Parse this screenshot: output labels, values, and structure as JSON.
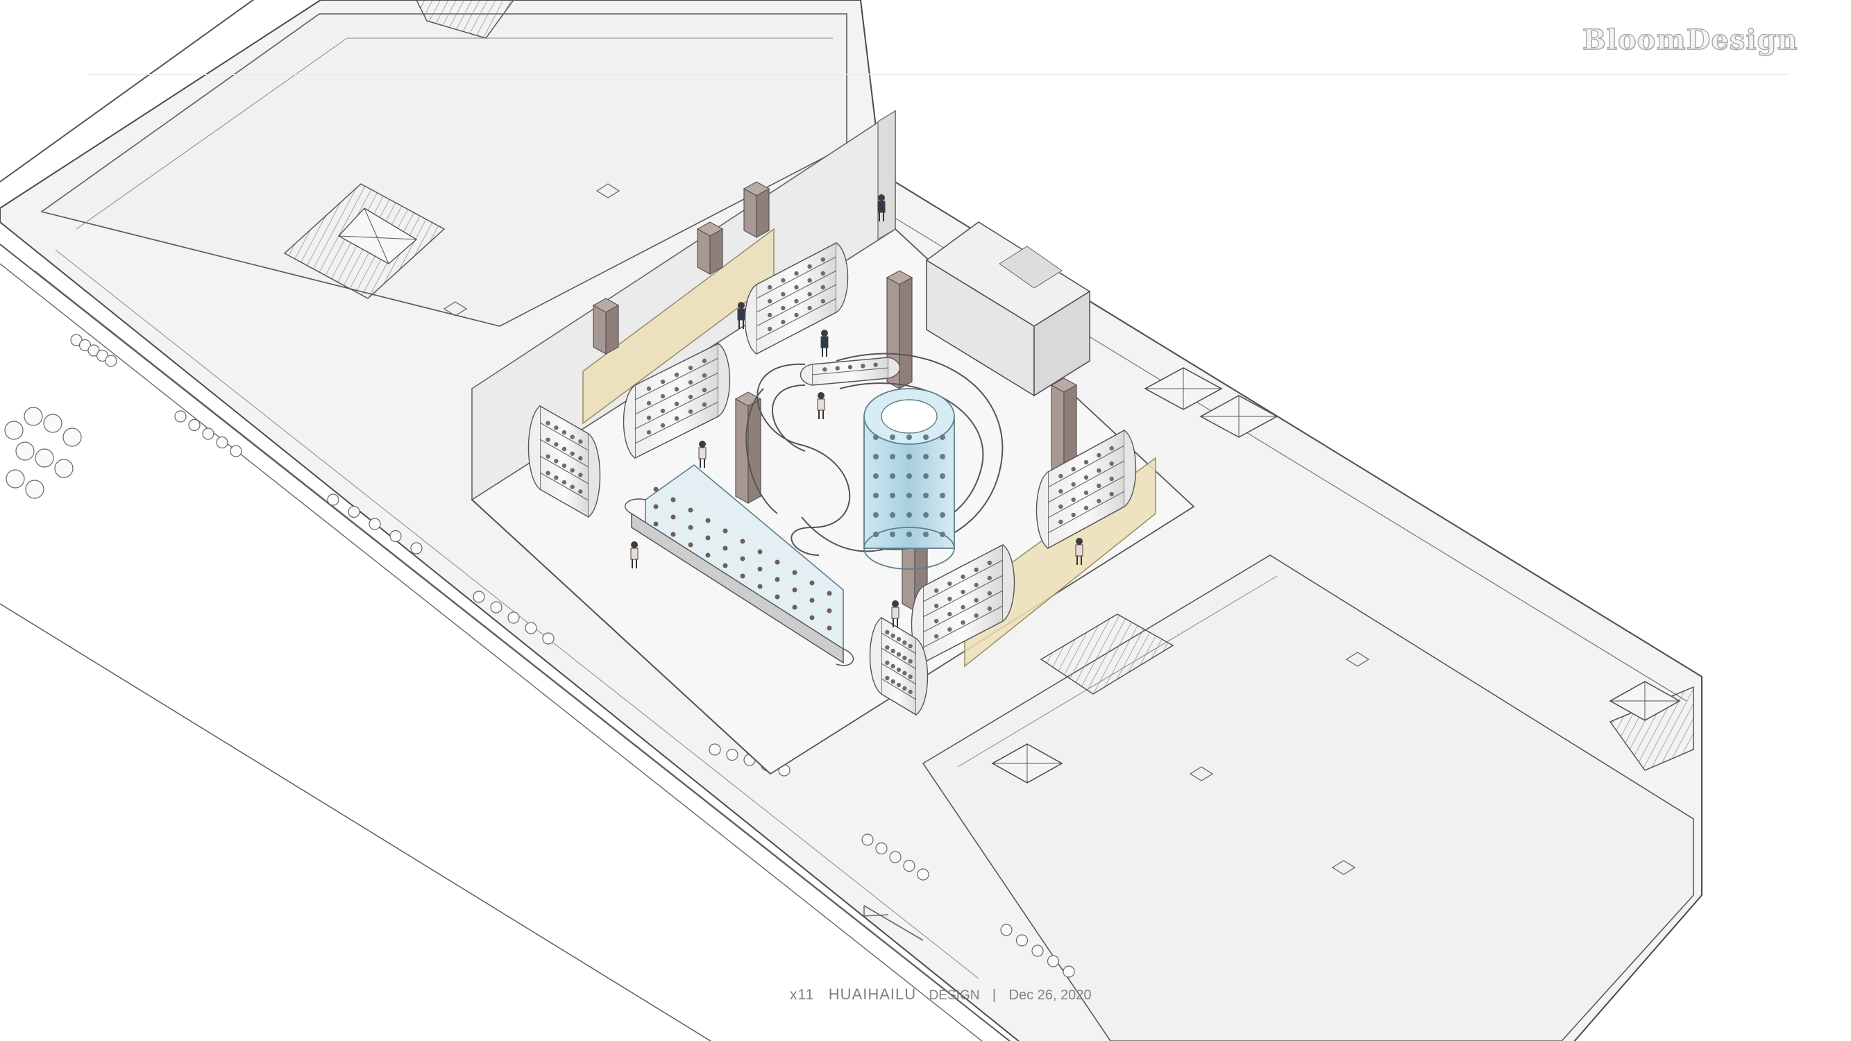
{
  "brand": {
    "logo_text": "BloomDesign"
  },
  "footer": {
    "code": "x11",
    "title": "HUAIHAILU",
    "kind": "DESIGN",
    "separator": "|",
    "date": "Dec 26, 2020"
  },
  "colors": {
    "floor": "#f2f2f2",
    "line": "#555555",
    "light_line": "#9a9a9a",
    "wall": "#e4e4e4",
    "pillar": "#a89894",
    "screen": "#eee3bf",
    "glass": "#bcd9e6"
  },
  "drawing": {
    "type": "isometric floor plan",
    "elements": [
      "stair-icon",
      "elevator-icon",
      "display-shelf",
      "spiral-glass-tower",
      "column",
      "yellow-panel",
      "person-figure"
    ]
  }
}
